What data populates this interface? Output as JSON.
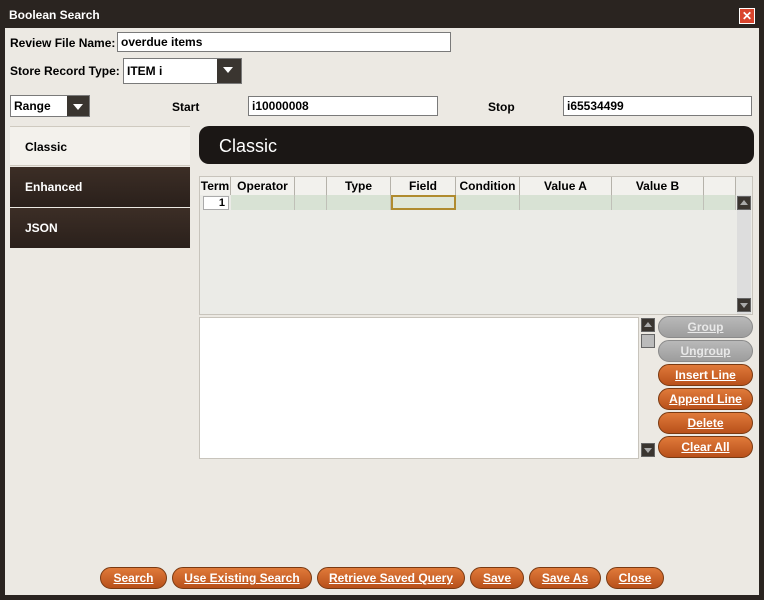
{
  "window": {
    "title": "Boolean Search"
  },
  "form": {
    "review_file_label": "Review File Name:",
    "review_file_value": "overdue items",
    "store_record_label": "Store Record Type:",
    "store_record_value": "ITEM  i",
    "range_value": "Range",
    "start_label": "Start",
    "start_value": "i10000008",
    "stop_label": "Stop",
    "stop_value": "i65534499"
  },
  "tabs": [
    {
      "label": "Classic",
      "active": true
    },
    {
      "label": "Enhanced",
      "active": false
    },
    {
      "label": "JSON",
      "active": false
    }
  ],
  "panel": {
    "title": "Classic"
  },
  "grid": {
    "columns": [
      "Term",
      "Operator",
      "",
      "Type",
      "Field",
      "Condition",
      "Value A",
      "Value B",
      ""
    ],
    "rows": [
      {
        "term": "1"
      }
    ]
  },
  "side_buttons": {
    "group": "Group",
    "ungroup": "Ungroup",
    "insert_line": "Insert Line",
    "append_line": "Append Line",
    "delete": "Delete",
    "clear_all": "Clear All"
  },
  "bottom_buttons": {
    "search": "Search",
    "use_existing": "Use Existing Search",
    "retrieve_saved": "Retrieve Saved Query",
    "save": "Save",
    "save_as": "Save As",
    "close": "Close"
  },
  "colors": {
    "accent": "#c8621f",
    "dark": "#1b1715",
    "panel_bg": "#ece9e3"
  }
}
